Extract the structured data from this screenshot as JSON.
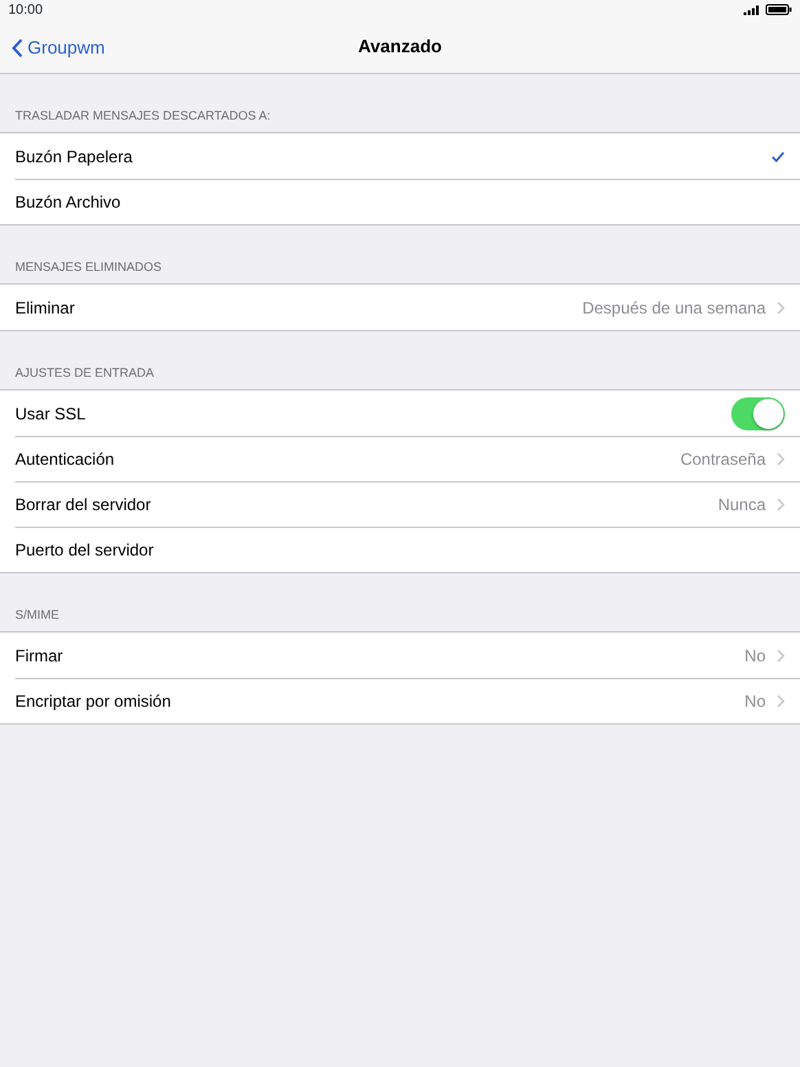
{
  "status_bar": {
    "time": "10:00"
  },
  "nav_bar": {
    "back": "Groupwm",
    "title": "Avanzado"
  },
  "sections": [
    {
      "header": "TRASLADAR MENSAJES DESCARTADOS A:",
      "rows": [
        {
          "kind": "choice",
          "label": "Buzón Papelera",
          "selected": true
        },
        {
          "kind": "choice",
          "label": "Buzón Archivo",
          "selected": false
        }
      ]
    },
    {
      "header": "MENSAJES ELIMINADOS",
      "rows": [
        {
          "kind": "link",
          "label": "Eliminar",
          "value": "Después de una semana"
        }
      ]
    },
    {
      "header": "AJUSTES DE ENTRADA",
      "rows": [
        {
          "kind": "toggle",
          "label": "Usar SSL",
          "on": true
        },
        {
          "kind": "link",
          "label": "Autenticación",
          "value": "Contraseña"
        },
        {
          "kind": "link",
          "label": "Borrar del servidor",
          "value": "Nunca"
        },
        {
          "kind": "plain",
          "label": "Puerto del servidor"
        }
      ]
    },
    {
      "header": "S/MIME",
      "rows": [
        {
          "kind": "link",
          "label": "Firmar",
          "value": "No"
        },
        {
          "kind": "link",
          "label": "Encriptar por omisión",
          "value": "No"
        }
      ]
    }
  ]
}
